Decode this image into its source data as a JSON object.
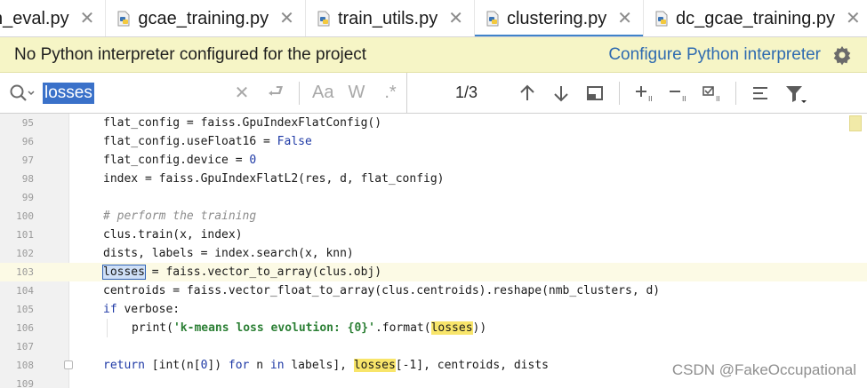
{
  "tabs": [
    {
      "label": "n_eval.py",
      "active": false
    },
    {
      "label": "gcae_training.py",
      "active": false
    },
    {
      "label": "train_utils.py",
      "active": false
    },
    {
      "label": "clustering.py",
      "active": true
    },
    {
      "label": "dc_gcae_training.py",
      "active": false
    }
  ],
  "banner": {
    "message": "No Python interpreter configured for the project",
    "action_link": "Configure Python interpreter"
  },
  "find": {
    "query": "losses",
    "match_counter": "1/3",
    "option_match_case": "Aa",
    "option_words": "W",
    "option_regex": ".*"
  },
  "editor": {
    "lines": [
      {
        "num": "95"
      },
      {
        "num": "96"
      },
      {
        "num": "97"
      },
      {
        "num": "98"
      },
      {
        "num": "99"
      },
      {
        "num": "100"
      },
      {
        "num": "101"
      },
      {
        "num": "102"
      },
      {
        "num": "103"
      },
      {
        "num": "104"
      },
      {
        "num": "105"
      },
      {
        "num": "106"
      },
      {
        "num": "107"
      },
      {
        "num": "108"
      },
      {
        "num": "109"
      }
    ],
    "code": {
      "l95": "flat_config = faiss.GpuIndexFlatConfig()",
      "l96a": "flat_config.useFloat16 = ",
      "l96b": "False",
      "l97a": "flat_config.device = ",
      "l97b": "0",
      "l98": "index = faiss.GpuIndexFlatL2(res, d, flat_config)",
      "l100": "# perform the training",
      "l101": "clus.train(x, index)",
      "l102": "dists, labels = index.search(x, knn)",
      "l103a": "losses",
      "l103b": " = faiss.vector_to_array(clus.obj)",
      "l104": "centroids = faiss.vector_float_to_array(clus.centroids).reshape(nmb_clusters, d)",
      "l105a": "if",
      "l105b": " verbose:",
      "l106a": "print(",
      "l106b": "'k-means loss evolution: {0}'",
      "l106c": ".format(",
      "l106d": "losses",
      "l106e": "))",
      "l108a": "return",
      "l108b": " [int(n[",
      "l108c": "0",
      "l108d": "]) ",
      "l108e": "for",
      "l108f": " n ",
      "l108g": "in",
      "l108h": " labels], ",
      "l108i": "losses",
      "l108j": "[-1], centroids, dists"
    }
  },
  "watermark": "CSDN @FakeOccupational",
  "colors": {
    "banner_bg": "#f6f5c6",
    "link": "#2f6bb0",
    "selection": "#3a71c9",
    "match_highlight": "#f8e56a",
    "keyword": "#1f3aa6",
    "string": "#2b7f34",
    "comment": "#8c8c8c",
    "active_tab_underline": "#4083c9"
  }
}
